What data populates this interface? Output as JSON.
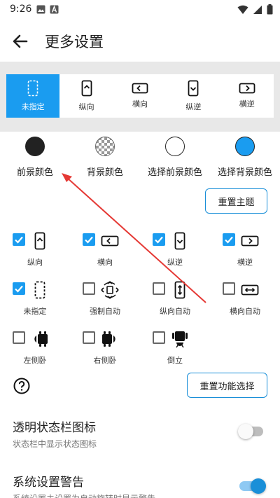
{
  "status_bar": {
    "time": "9:26",
    "icons": [
      "image-icon",
      "a-letter-icon",
      "wifi-icon",
      "signal-icon",
      "battery-icon"
    ]
  },
  "app_bar": {
    "title": "更多设置",
    "back_icon": "arrow-left-icon"
  },
  "orientation_tabs": [
    {
      "label": "未指定",
      "icon": "phone-unspecified-icon",
      "selected": true
    },
    {
      "label": "纵向",
      "icon": "phone-portrait-icon",
      "selected": false
    },
    {
      "label": "横向",
      "icon": "phone-landscape-icon",
      "selected": false
    },
    {
      "label": "纵逆",
      "icon": "phone-portrait-reverse-icon",
      "selected": false
    },
    {
      "label": "横逆",
      "icon": "phone-landscape-reverse-icon",
      "selected": false
    }
  ],
  "colors": [
    {
      "label": "前景颜色",
      "swatch": "#222222"
    },
    {
      "label": "背景颜色",
      "swatch": "checkerboard"
    },
    {
      "label": "选择前景颜色",
      "swatch": "#ffffff"
    },
    {
      "label": "选择背景颜色",
      "swatch": "#1a9cf0"
    }
  ],
  "reset_theme_button": "重置主题",
  "features": [
    {
      "label": "纵向",
      "checked": true,
      "icon": "phone-portrait-icon"
    },
    {
      "label": "横向",
      "checked": true,
      "icon": "phone-landscape-icon"
    },
    {
      "label": "纵逆",
      "checked": true,
      "icon": "phone-portrait-reverse-icon"
    },
    {
      "label": "横逆",
      "checked": true,
      "icon": "phone-landscape-reverse-icon"
    },
    {
      "label": "未指定",
      "checked": true,
      "icon": "phone-unspecified-icon"
    },
    {
      "label": "强制自动",
      "checked": false,
      "icon": "rotate-arrows-icon"
    },
    {
      "label": "纵向自动",
      "checked": false,
      "icon": "phone-portrait-auto-icon"
    },
    {
      "label": "横向自动",
      "checked": false,
      "icon": "phone-landscape-auto-icon"
    },
    {
      "label": "左侧卧",
      "checked": false,
      "icon": "android-left-icon"
    },
    {
      "label": "右侧卧",
      "checked": false,
      "icon": "android-right-icon"
    },
    {
      "label": "倒立",
      "checked": false,
      "icon": "android-upside-down-icon"
    }
  ],
  "reset_features_button": "重置功能选择",
  "settings": [
    {
      "title": "透明状态栏图标",
      "subtitle": "状态栏中显示状态图标",
      "enabled": false
    },
    {
      "title": "系统设置警告",
      "subtitle": "系统设置未设置为自动旋转时显示警告",
      "enabled": true
    }
  ],
  "colors_theme": {
    "accent": "#1a9cf0",
    "annotation": "#e53935"
  }
}
